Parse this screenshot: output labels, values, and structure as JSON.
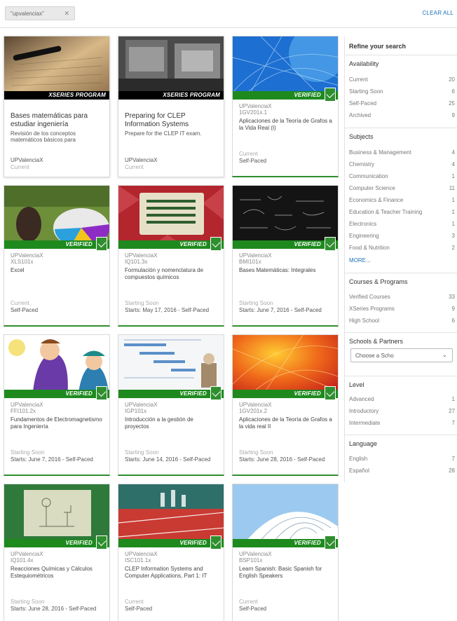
{
  "filter_chip": {
    "label": "\"upvalenciax\"",
    "remove_icon": "close-icon"
  },
  "clear_all": "CLEAR ALL",
  "colors": {
    "link": "#1a72b8",
    "verified": "#1e8a1e",
    "xseries_band": "#000000"
  },
  "cards": [
    {
      "kind": "xseries",
      "band": "XSERIES PROGRAM",
      "title": "Bases matemáticas para estudiar ingeniería",
      "desc": "Revisión de los conceptos matemáticos básicos para",
      "org": "UPValenciaX",
      "status": "Current"
    },
    {
      "kind": "xseries",
      "band": "XSERIES PROGRAM",
      "title": "Preparing for CLEP Information Systems",
      "desc": "Prepare for the CLEP IT exam.",
      "org": "UPValenciaX",
      "status": "Current"
    },
    {
      "kind": "verified",
      "band": "VERIFIED",
      "org": "UPValenciaX",
      "code": "1GV201x.1",
      "title": "Aplicaciones de la Teoría de Grafos a la Vida Real (I)",
      "status": "Current",
      "pace": "Self-Paced"
    },
    {
      "kind": "verified",
      "band": "VERIFIED",
      "org": "UPValenciaX",
      "code": "XLS101x",
      "title": "Excel",
      "status": "Current",
      "pace": "Self-Paced"
    },
    {
      "kind": "verified",
      "band": "VERIFIED",
      "org": "UPValenciaX",
      "code": "IQ101.3x",
      "title": "Formulación y nomenclatura de compuestos químicos",
      "status": "Starting Soon",
      "pace": "Starts: May 17, 2016 - Self-Paced"
    },
    {
      "kind": "verified",
      "band": "VERIFIED",
      "org": "UPValenciaX",
      "code": "BMI101x",
      "title": "Bases Matemáticas: Integrales",
      "status": "Starting Soon",
      "pace": "Starts: June 7, 2016 - Self-Paced"
    },
    {
      "kind": "verified",
      "band": "VERIFIED",
      "org": "UPValenciaX",
      "code": "FFI101.2x",
      "title": "Fundamentos de Electromagnetismo para Ingeniería",
      "status": "Starting Soon",
      "pace": "Starts: June 7, 2016 - Self-Paced"
    },
    {
      "kind": "verified",
      "band": "VERIFIED",
      "org": "UPValenciaX",
      "code": "IGP101x",
      "title": "Introducción a la gestión de proyectos",
      "status": "Starting Soon",
      "pace": "Starts: June 14, 2016 - Self-Paced"
    },
    {
      "kind": "verified",
      "band": "VERIFIED",
      "org": "UPValenciaX",
      "code": "1GV201x.2",
      "title": "Aplicaciones de la Teoría de Grafos a la vida real II",
      "status": "Starting Soon",
      "pace": "Starts: June 28, 2016 - Self-Paced"
    },
    {
      "kind": "verified",
      "band": "VERIFIED",
      "org": "UPValenciaX",
      "code": "IQ101.4x",
      "title": "Reacciones Químicas y Cálculos Estequiométricos",
      "status": "Starting Soon",
      "pace": "Starts: June 28, 2016 - Self-Paced"
    },
    {
      "kind": "verified",
      "band": "VERIFIED",
      "org": "UPValenciaX",
      "code": "ISC101.1x",
      "title": "CLEP Information Systems and Computer Applications, Part 1: IT",
      "status": "Current",
      "pace": "Self-Paced"
    },
    {
      "kind": "verified",
      "band": "VERIFIED",
      "org": "UPValenciaX",
      "code": "BSP101x",
      "title": "Learn Spanish: Basic Spanish for English Speakers",
      "status": "Current",
      "pace": "Self-Paced"
    }
  ],
  "sidebar": {
    "heading": "Refine your search",
    "availability": {
      "title": "Availability",
      "items": [
        {
          "label": "Current",
          "count": "20"
        },
        {
          "label": "Starting Soon",
          "count": "6"
        },
        {
          "label": "Self-Paced",
          "count": "25"
        },
        {
          "label": "Archived",
          "count": "9"
        }
      ]
    },
    "subjects": {
      "title": "Subjects",
      "more": "MORE...",
      "items": [
        {
          "label": "Business & Management",
          "count": "4"
        },
        {
          "label": "Chemistry",
          "count": "4"
        },
        {
          "label": "Communication",
          "count": "1"
        },
        {
          "label": "Computer Science",
          "count": "11"
        },
        {
          "label": "Economics & Finance",
          "count": "1"
        },
        {
          "label": "Education & Teacher Training",
          "count": "1"
        },
        {
          "label": "Electronics",
          "count": "1"
        },
        {
          "label": "Engineering",
          "count": "3"
        },
        {
          "label": "Food & Nutrition",
          "count": "2"
        }
      ]
    },
    "programs": {
      "title": "Courses & Programs",
      "items": [
        {
          "label": "Verified Courses",
          "count": "33"
        },
        {
          "label": "XSeries Programs",
          "count": "9"
        },
        {
          "label": "High School",
          "count": "6"
        }
      ]
    },
    "schools": {
      "title": "Schools & Partners",
      "select_value": "Choose a Scho"
    },
    "level": {
      "title": "Level",
      "items": [
        {
          "label": "Advanced",
          "count": "1"
        },
        {
          "label": "Introductory",
          "count": "27"
        },
        {
          "label": "Intermediate",
          "count": "7"
        }
      ]
    },
    "language": {
      "title": "Language",
      "items": [
        {
          "label": "English",
          "count": "7"
        },
        {
          "label": "Español",
          "count": "28"
        }
      ]
    }
  }
}
